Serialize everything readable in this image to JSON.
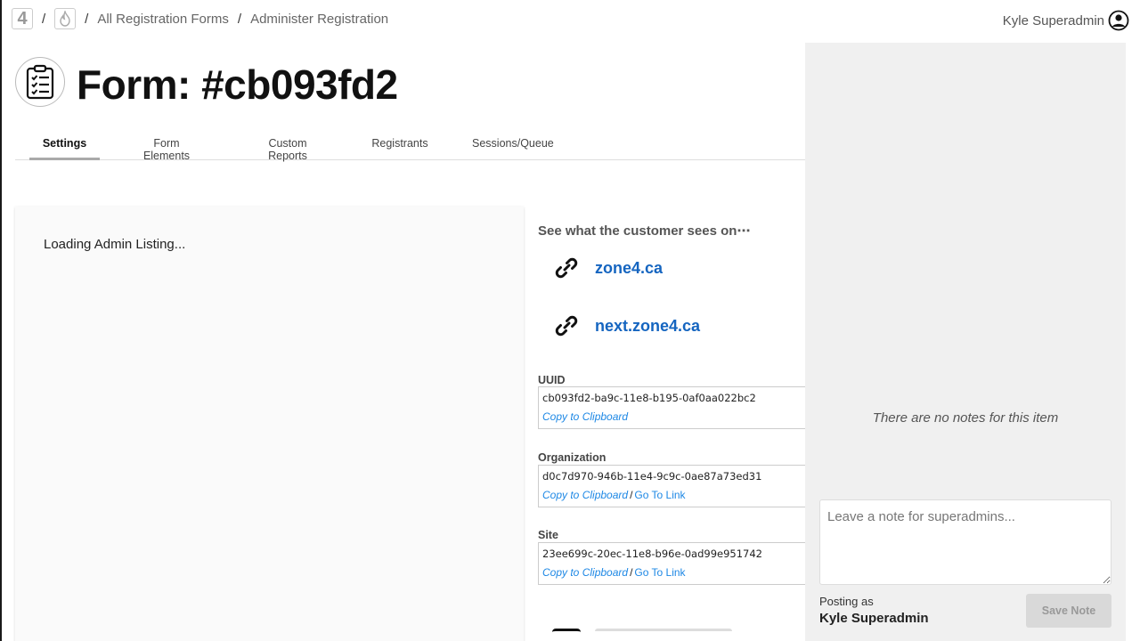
{
  "breadcrumb": {
    "logo_text": "4",
    "separator": "/",
    "items": [
      "All Registration Forms",
      "Administer Registration"
    ]
  },
  "user": {
    "name": "Kyle Superadmin"
  },
  "page": {
    "title": "Form: #cb093fd2"
  },
  "tabs": [
    {
      "label": "Settings",
      "active": true
    },
    {
      "label": "Form Elements",
      "active": false
    },
    {
      "label": "Custom Reports",
      "active": false
    },
    {
      "label": "Registrants",
      "active": false
    },
    {
      "label": "Sessions/Queue",
      "active": false
    }
  ],
  "loading": {
    "text": "Loading Admin Listing..."
  },
  "customer_view": {
    "heading": "See what the customer sees on⋯",
    "links": [
      "zone4.ca",
      "next.zone4.ca"
    ]
  },
  "fields": {
    "uuid": {
      "label": "UUID",
      "value": "cb093fd2-ba9c-11e8-b195-0af0aa022bc2",
      "copy": "Copy to Clipboard"
    },
    "organization": {
      "label": "Organization",
      "value": "d0c7d970-946b-11e4-9c9c-0ae87a73ed31",
      "copy": "Copy to Clipboard",
      "slash": "/",
      "goto": "Go To Link"
    },
    "site": {
      "label": "Site",
      "value": "23ee699c-20ec-11e8-b96e-0ad99e951742",
      "copy": "Copy to Clipboard",
      "slash": "/",
      "goto": "Go To Link"
    }
  },
  "notes": {
    "empty_text": "There are no notes for this item",
    "placeholder": "Leave a note for superadmins...",
    "posting_as_label": "Posting as",
    "posting_as_user": "Kyle Superadmin",
    "save_label": "Save Note"
  },
  "colors": {
    "link": "#1565c0",
    "copy_link": "#1e88e5",
    "sidebar_bg": "#f0f0f0"
  }
}
